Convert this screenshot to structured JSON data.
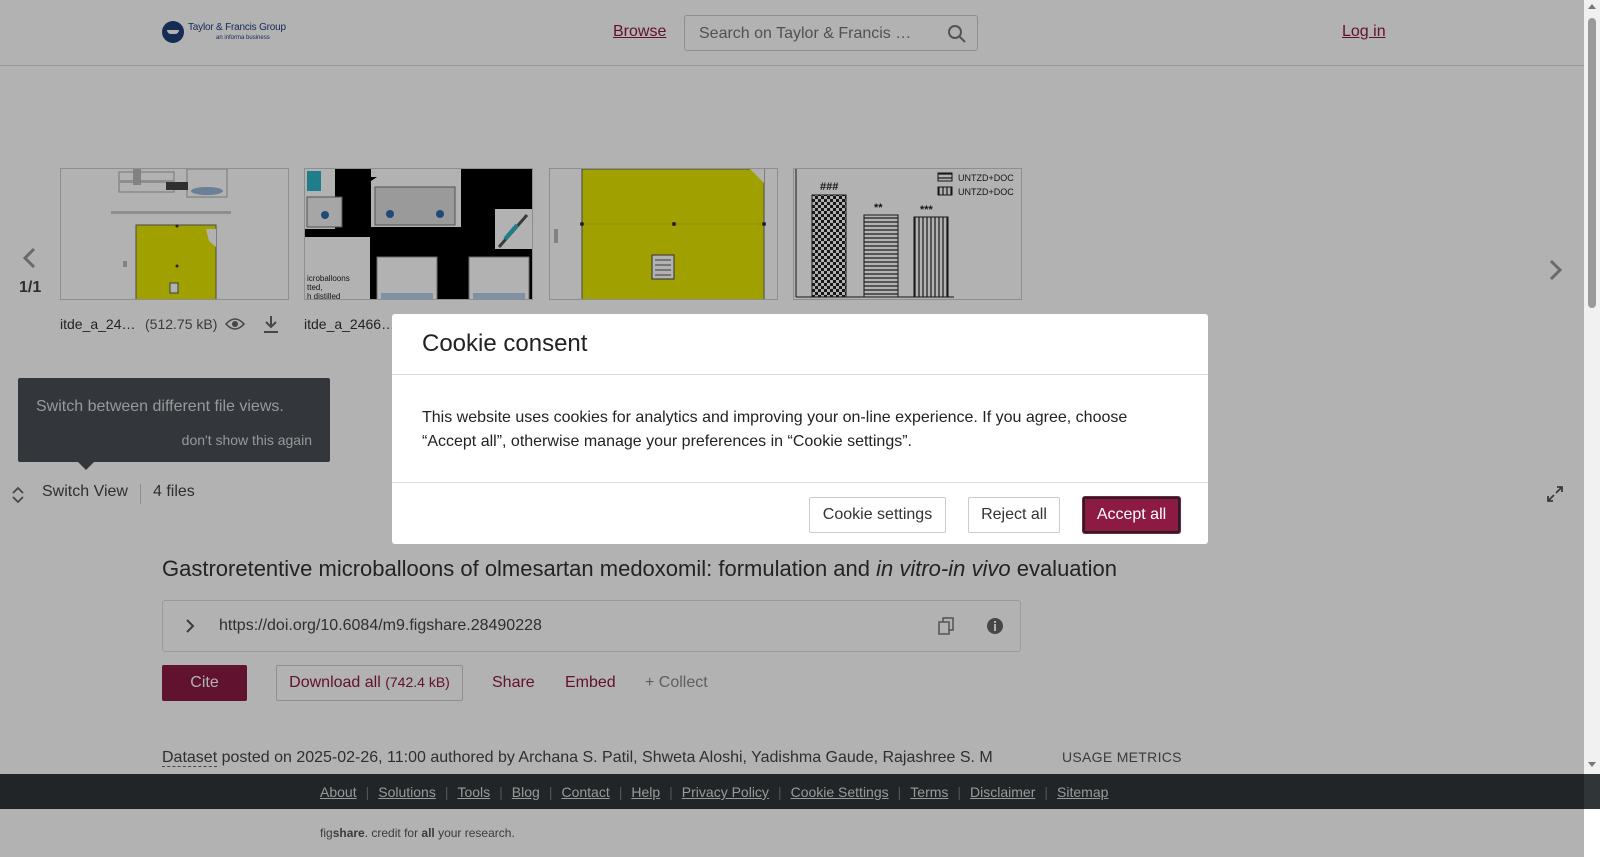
{
  "header": {
    "logo_name": "Taylor & Francis Group",
    "logo_sub": "an informa business",
    "browse": "Browse",
    "search_placeholder": "Search on Taylor & Francis …",
    "login": "Log in"
  },
  "viewer": {
    "page_count": "1/1",
    "thumbnails": [
      {
        "label": "itde_a_24…",
        "size": "(512.75 kB)"
      },
      {
        "label": "itde_a_2466…"
      }
    ],
    "thumb4_legend": [
      "UNTZD+DOC",
      "UNTZD+DOC"
    ],
    "thumb4_marks": [
      "###",
      "**",
      "***"
    ],
    "tooltip_text": "Switch between different file views.",
    "tooltip_link": "don't show this again",
    "switch_view": "Switch View",
    "files_count": "4 files"
  },
  "article": {
    "title_prefix": "Gastroretentive microballoons of olmesartan medoxomil: formulation and ",
    "title_italic": "in vitro-in vivo",
    "title_suffix": " evaluation",
    "doi": "https://doi.org/10.6084/m9.figshare.28490228",
    "cite": "Cite",
    "download_label": "Download all",
    "download_size": "(742.4 kB)",
    "share": "Share",
    "embed": "Embed",
    "collect": "+ Collect",
    "meta_type": "Dataset",
    "meta_text": " posted on 2025-02-26, 11:00 authored by Archana S. Patil, Shweta Aloshi, Yadishma Gaude, Rajashree S. Masareddy",
    "usage_metrics": "USAGE METRICS"
  },
  "footer": {
    "links": [
      "About",
      "Solutions",
      "Tools",
      "Blog",
      "Contact",
      "Help",
      "Privacy Policy",
      "Cookie Settings",
      "Terms",
      "Disclaimer",
      "Sitemap"
    ],
    "tag_prefix": "fig",
    "tag_brand": "share",
    "tag_mid": ". credit for ",
    "tag_bold": "all",
    "tag_suffix": " your research."
  },
  "cookie": {
    "title": "Cookie consent",
    "body": "This website uses cookies for analytics and improving your on-line experience. If you agree, choose “Accept all”, otherwise manage your preferences in “Cookie settings”.",
    "settings": "Cookie settings",
    "reject": "Reject all",
    "accept": "Accept all"
  },
  "colors": {
    "brand": "#8c1a43",
    "footer_bg": "#303538",
    "figure_yellow": "#e6e600"
  }
}
